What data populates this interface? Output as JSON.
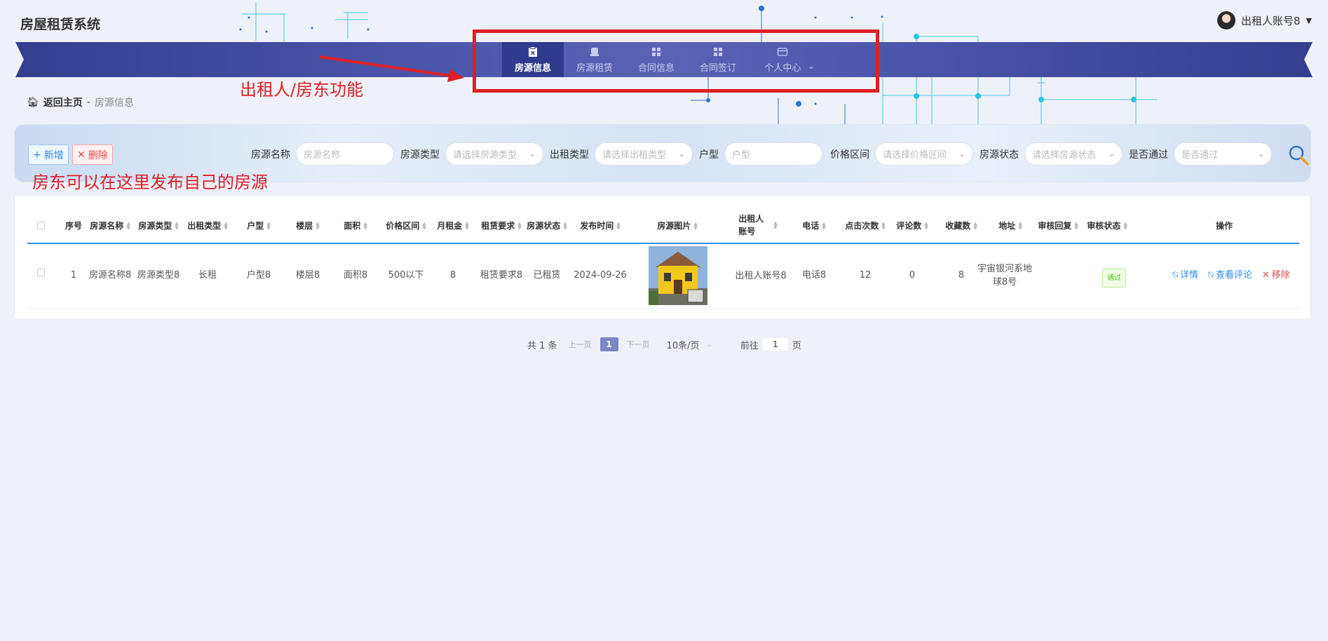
{
  "app": {
    "title": "房屋租赁系统"
  },
  "user": {
    "name": "出租人账号8"
  },
  "nav": {
    "items": [
      {
        "label": "房源信息",
        "icon": "clipboard-icon",
        "active": true
      },
      {
        "label": "房源租赁",
        "icon": "bed-icon"
      },
      {
        "label": "合同信息",
        "icon": "grid-icon"
      },
      {
        "label": "合同签订",
        "icon": "grid-icon"
      },
      {
        "label": "个人中心",
        "icon": "card-icon",
        "dropdown": true
      }
    ]
  },
  "annotations": {
    "nav_note": "出租人/房东功能",
    "publish_note": "房东可以在这里发布自己的房源"
  },
  "breadcrumb": {
    "home": "返回主页",
    "separator": "-",
    "current": "房源信息"
  },
  "toolbar": {
    "add_label": "新增",
    "delete_label": "删除"
  },
  "filters": [
    {
      "label": "房源名称",
      "placeholder": "房源名称",
      "type": "input"
    },
    {
      "label": "房源类型",
      "placeholder": "请选择房源类型",
      "type": "select"
    },
    {
      "label": "出租类型",
      "placeholder": "请选择出租类型",
      "type": "select"
    },
    {
      "label": "户型",
      "placeholder": "户型",
      "type": "input"
    },
    {
      "label": "价格区间",
      "placeholder": "请选择价格区间",
      "type": "select"
    },
    {
      "label": "房源状态",
      "placeholder": "请选择房源状态",
      "type": "select"
    },
    {
      "label": "是否通过",
      "placeholder": "是否通过",
      "type": "select"
    }
  ],
  "table": {
    "columns": [
      "序号",
      "房源名称",
      "房源类型",
      "出租类型",
      "户型",
      "楼层",
      "面积",
      "价格区间",
      "月租金",
      "租赁要求",
      "房源状态",
      "发布时间",
      "房源图片",
      "出租人账号",
      "电话",
      "点击次数",
      "评论数",
      "收藏数",
      "地址",
      "审核回复",
      "审核状态",
      "操作"
    ],
    "rows": [
      {
        "index": "1",
        "name": "房源名称8",
        "house_type": "房源类型8",
        "rent_type": "长租",
        "layout": "户型8",
        "floor": "楼层8",
        "area": "面积8",
        "price_range": "500以下",
        "monthly_rent": "8",
        "requirement": "租赁要求8",
        "status": "已租赁",
        "publish_time": "2024-09-26",
        "owner_account": "出租人账号8",
        "phone": "电话8",
        "clicks": "12",
        "comments": "0",
        "favorites": "8",
        "address": "宇宙银河系地球8号",
        "review_reply": "",
        "review_status": "通过"
      }
    ],
    "actions": {
      "detail": "详情",
      "comments": "查看评论",
      "remove": "移除"
    }
  },
  "pagination": {
    "total": "共 1 条",
    "prev": "上一页",
    "current": "1",
    "next": "下一页",
    "page_size": "10条/页",
    "goto_prefix": "前往",
    "goto_value": "1",
    "goto_suffix": "页"
  },
  "colors": {
    "nav_bg": "#5a64b4",
    "nav_active": "#2f3b8c",
    "accent": "#2d8cf0",
    "annotation": "#e01f26"
  }
}
